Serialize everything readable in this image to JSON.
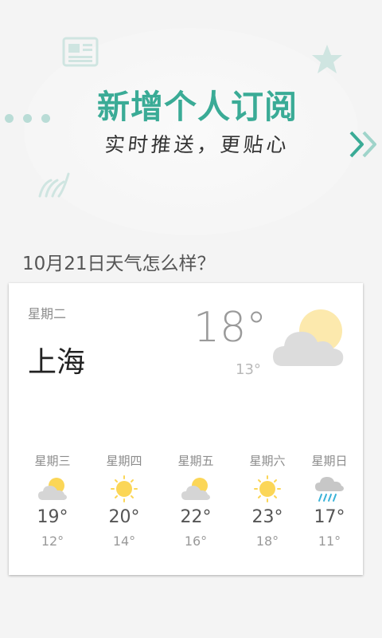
{
  "banner": {
    "title": "新增个人订阅",
    "subtitle": "实时推送，更贴心",
    "accent_color": "#3aab96",
    "icons": [
      "newspaper-icon",
      "star-icon",
      "dots-icon",
      "wave-icon",
      "double-chevron-right-icon"
    ]
  },
  "question": "10月21日天气怎么样？",
  "today": {
    "weekday": "星期二",
    "city": "上海",
    "high": "18°",
    "low": "13°",
    "icon": "partly-cloudy-icon"
  },
  "forecast": [
    {
      "day": "星期三",
      "high": "19°",
      "low": "12°",
      "icon": "partly-cloudy-icon"
    },
    {
      "day": "星期四",
      "high": "20°",
      "low": "14°",
      "icon": "sunny-icon"
    },
    {
      "day": "星期五",
      "high": "22°",
      "low": "16°",
      "icon": "partly-cloudy-icon"
    },
    {
      "day": "星期六",
      "high": "23°",
      "low": "18°",
      "icon": "sunny-icon"
    },
    {
      "day": "星期日",
      "high": "17°",
      "low": "11°",
      "icon": "rain-icon"
    }
  ]
}
